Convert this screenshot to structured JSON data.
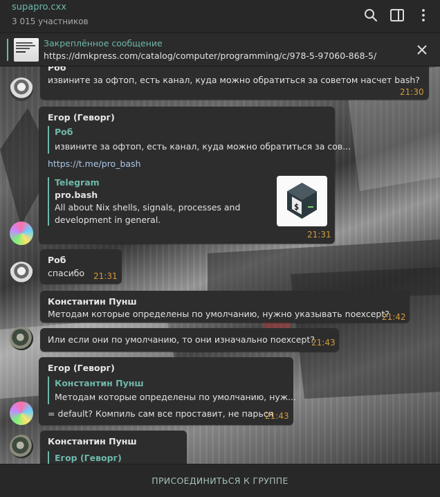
{
  "header": {
    "title": "supapro.cxx",
    "subtitle": "3 015 участников",
    "icons": [
      "search-icon",
      "sidebar-icon",
      "more-vert-icon"
    ]
  },
  "pinned": {
    "title": "Закреплённое сообщение",
    "url": "https://dmkpress.com/catalog/computer/programming/c/978-5-97060-868-5/"
  },
  "messages": {
    "m1": {
      "sender": "Роб",
      "text": "извините за офтоп, есть канал, куда можно обратиться за советом насчет bash?",
      "time": "21:30"
    },
    "m2": {
      "sender": "Егор (Геворг)",
      "reply_name": "Роб",
      "reply_text": "извините за офтоп, есть канал, куда можно обратиться за сов...",
      "link": "https://t.me/pro_bash",
      "preview_site": "Telegram",
      "preview_title": "pro.bash",
      "preview_desc_1": "All about Nix shells, signals, processes and",
      "preview_desc_2": "development in general.",
      "time": "21:31"
    },
    "m3": {
      "sender": "Роб",
      "text": "спасибо",
      "time": "21:31"
    },
    "m4": {
      "sender": "Константин Пунш",
      "text": "Методам которые определены по умолчанию, нужно указывать noexcept?",
      "time": "21:42"
    },
    "m5": {
      "text": "Или если они по умолчанию, то они изначально noexcept?",
      "time": "21:43"
    },
    "m6": {
      "sender": "Егор (Геворг)",
      "reply_name": "Константин Пунш",
      "reply_text": "Методам которые определены по умолчанию, нуж...",
      "text": "= default? Компиль сам все проставит, не парься",
      "time": "21:43"
    },
    "m7": {
      "sender": "Константин Пунш",
      "reply_name": "Егор (Геворг)"
    }
  },
  "footer": {
    "join_label": "ПРИСОЕДИНИТЬСЯ К ГРУППЕ"
  },
  "colors": {
    "accent": "#6fb8ab",
    "time": "#d59a3a",
    "bubble": "#2d2d2d",
    "header": "#282828"
  }
}
